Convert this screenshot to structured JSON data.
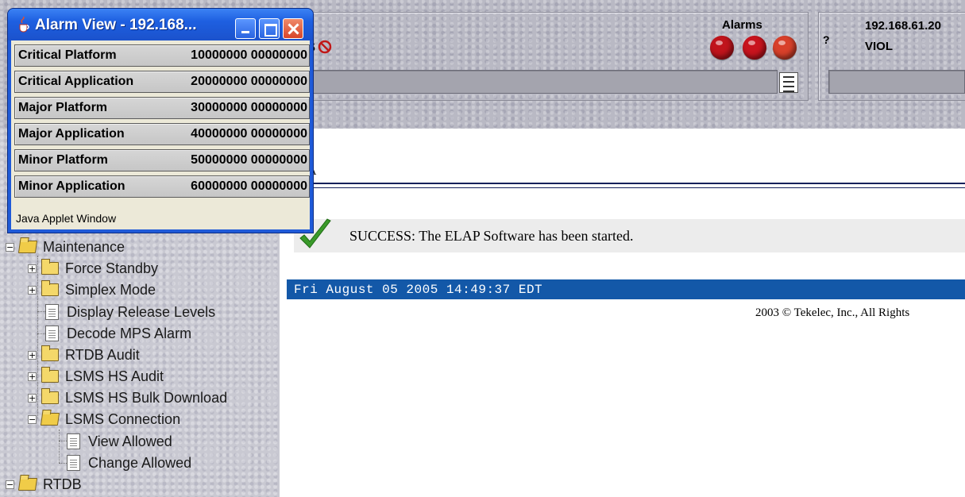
{
  "banner": {
    "status_fragment": "s",
    "alarms_label": "Alarms",
    "question_mark": "?",
    "server_ip": "192.168.61.20",
    "server_state": "VIOL",
    "alarm_led_colors": [
      "#c0141c",
      "#c8141e",
      "#d8402a"
    ]
  },
  "alarm_window": {
    "title": "Alarm View - 192.168...",
    "rows": [
      {
        "name": "Critical Platform",
        "code": "10000000 00000000"
      },
      {
        "name": "Critical Application",
        "code": "20000000 00000000"
      },
      {
        "name": "Major Platform",
        "code": "30000000 00000000"
      },
      {
        "name": "Major Application",
        "code": "40000000 00000000"
      },
      {
        "name": "Minor Platform",
        "code": "50000000 00000000"
      },
      {
        "name": "Minor Application",
        "code": "60000000 00000000"
      }
    ],
    "footer": "Java Applet Window"
  },
  "nav": {
    "items": [
      {
        "label": "Maintenance"
      },
      {
        "label": "Force Standby"
      },
      {
        "label": "Simplex Mode"
      },
      {
        "label": "Display Release Levels"
      },
      {
        "label": "Decode MPS Alarm"
      },
      {
        "label": "RTDB Audit"
      },
      {
        "label": "LSMS HS Audit"
      },
      {
        "label": "LSMS HS Bulk Download"
      },
      {
        "label": "LSMS Connection"
      },
      {
        "label": "View Allowed"
      },
      {
        "label": "Change Allowed"
      },
      {
        "label": "RTDB"
      }
    ]
  },
  "main": {
    "heading_fragment": "A",
    "success_message": "SUCCESS: The ELAP Software has been started.",
    "timestamp": "Fri August 05 2005 14:49:37 EDT",
    "copyright": "2003 © Tekelec, Inc., All Rights"
  },
  "colors": {
    "date_bar": "#1358a8",
    "window_title_bar": "#1e5fe0",
    "success_check": "#3a9a2a"
  }
}
